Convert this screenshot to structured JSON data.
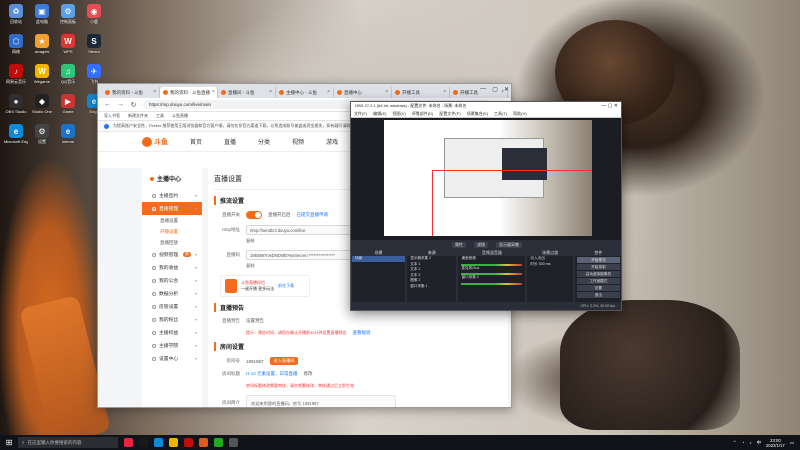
{
  "desktop": {
    "icons": [
      {
        "label": "回收站",
        "color": "#5a8fd8",
        "glyph": "♻"
      },
      {
        "label": "此电脑",
        "color": "#3d7bd8",
        "glyph": "▣"
      },
      {
        "label": "控制面板",
        "color": "#5aa0e8",
        "glyph": "⚙"
      },
      {
        "label": "小鹿",
        "color": "#e84c55",
        "glyph": "◉"
      },
      {
        "label": "网络",
        "color": "#2e6cc8",
        "glyph": "⬡"
      },
      {
        "label": "alvageis",
        "color": "#f0a030",
        "glyph": "★"
      },
      {
        "label": "WPS",
        "color": "#d33",
        "glyph": "W"
      },
      {
        "label": "Steam",
        "color": "#1b2838",
        "glyph": "S"
      },
      {
        "label": "网易云音乐",
        "color": "#c20c0c",
        "glyph": "♪"
      },
      {
        "label": "Wegame",
        "color": "#f0b400",
        "glyph": "W"
      },
      {
        "label": "QQ音乐",
        "color": "#31c27c",
        "glyph": "♫"
      },
      {
        "label": "飞书",
        "color": "#3370ff",
        "glyph": "✈"
      },
      {
        "label": "OBS Studio",
        "color": "#302e31",
        "glyph": "●"
      },
      {
        "label": "Studio One",
        "color": "#222",
        "glyph": "◆"
      },
      {
        "label": "Game",
        "color": "#c33",
        "glyph": "▶"
      },
      {
        "label": "Edge",
        "color": "#0f8ad6",
        "glyph": "e"
      },
      {
        "label": "Microsoft Edge",
        "color": "#0f8ad6",
        "glyph": "e"
      },
      {
        "label": "设置",
        "color": "#444",
        "glyph": "⚙"
      },
      {
        "label": "Interne",
        "color": "#1a73c8",
        "glyph": "e"
      }
    ]
  },
  "browser": {
    "tabs": [
      "我的资料 - 斗鱼",
      "我的资料 - 斗鱼直播",
      "直播间 - 斗鱼",
      "主播中心 - 斗鱼",
      "直播中心",
      "开播工具",
      "开播工具"
    ],
    "url": "https://mp.douyu.com/live/main",
    "bookmarks": [
      "导入书签",
      "新建文件夹",
      "工具",
      "斗鱼直播"
    ],
    "notice": "为提高账户安全性，Firefox 推荐使用正版浏览器和官方客户端，请勿在非官方渠道下载，以免造成账号被盗或资金损失，如有疑问请联系客服。",
    "site": {
      "logo": "斗鱼",
      "nav": [
        "首页",
        "直播",
        "分类",
        "视频",
        "游戏",
        "鱼吧"
      ]
    },
    "sidebar": {
      "title": "主播中心",
      "items": [
        {
          "label": "主播签约",
          "active": false
        },
        {
          "label": "直播管理",
          "active": true
        },
        {
          "label": "直播设置",
          "sub": true,
          "on": false
        },
        {
          "label": "开播设置",
          "sub": true,
          "on": true
        },
        {
          "label": "直播回放",
          "sub": true,
          "on": false
        },
        {
          "label": "视频管理",
          "badge": "新"
        },
        {
          "label": "我的收益"
        },
        {
          "label": "我的公会"
        },
        {
          "label": "数据分析"
        },
        {
          "label": "房管设置"
        },
        {
          "label": "我的粉丝"
        },
        {
          "label": "主播权益"
        },
        {
          "label": "主播学院"
        },
        {
          "label": "设置中心"
        }
      ]
    },
    "main": {
      "page_title": "直播设置",
      "push_section": "推流设置",
      "push_toggle_label": "直播开关",
      "push_tip": "直播开启后",
      "push_link": "已提交直播申请",
      "rtmp_label": "rtmp地址",
      "rtmp_value": "rtmp://sendtc3.douyu.com/live",
      "copy": "复制",
      "code_label": "直播码",
      "code_value": "1893987rvsDNDMb?wsSecret=****************",
      "promo_title": "斗鱼直播伴侣",
      "promo_sub": "一键开播 更多玩法",
      "promo_btn": "前往下载",
      "preview_section": "直播预告",
      "preview_label": "直播预告",
      "preview_value": "设置预告",
      "preview_note": "提示：预告时间，请您在确认开播前30分钟设置直播预告",
      "preview_link": "查看规则",
      "room_section": "房间设置",
      "room_id_label": "房间号",
      "room_id_value": "1891987",
      "room_btn": "进入直播间",
      "room_title_label": "房间标题",
      "room_title_value": "H-12 元素设置，日常直播",
      "room_title_edit": "修改",
      "room_title_note": "房间标题修改需要审核，请勿频繁修改，审核通过后立即生效",
      "intro_label": "房间简介",
      "intro_value": "欢迎来到我的直播间，房号 1891987"
    }
  },
  "obs": {
    "title": "OBS 27.2.1 (64 bit, windows) - 配置文件: 未命名 - 场景: 未命名",
    "menu": [
      "文件(F)",
      "编辑(E)",
      "视图(V)",
      "停靠部件(D)",
      "配置文件(P)",
      "场景集合(S)",
      "工具(T)",
      "帮助(H)"
    ],
    "toolbar": [
      "属性",
      "滤镜",
      "显示器采集"
    ],
    "docks": {
      "scenes": {
        "title": "场景",
        "items": [
          "场景"
        ]
      },
      "sources": {
        "title": "来源",
        "items": [
          "显示器采集 2",
          "文本 1",
          "文本 2",
          "文本 3",
          "图像 2",
          "窗口采集 1"
        ]
      },
      "mixer": {
        "title": "音频混音器",
        "items": [
          "桌面音频",
          "麦克风/Aux",
          "窗口采集 2"
        ]
      },
      "transitions": {
        "title": "场景过渡",
        "fade": "淡入淡出",
        "duration_label": "时长",
        "duration": "300 ms"
      },
      "controls": {
        "title": "控件",
        "buttons": [
          "开始推流",
          "开始录制",
          "启动虚拟摄像机",
          "工作室模式",
          "设置",
          "退出"
        ],
        "highlight": 0
      }
    },
    "status": "CPU: 3.3%, 30.00 fps"
  },
  "taskbar": {
    "search_placeholder": "在这里输入你要搜索的内容",
    "time": "23:00",
    "date": "2022/1/17",
    "lang": "中",
    "apps_colors": [
      "#e24",
      "#1a1a1a",
      "#0f8ad6",
      "#f0b400",
      "#c20c0c",
      "#e05a20",
      "#2a2",
      "#555"
    ]
  }
}
